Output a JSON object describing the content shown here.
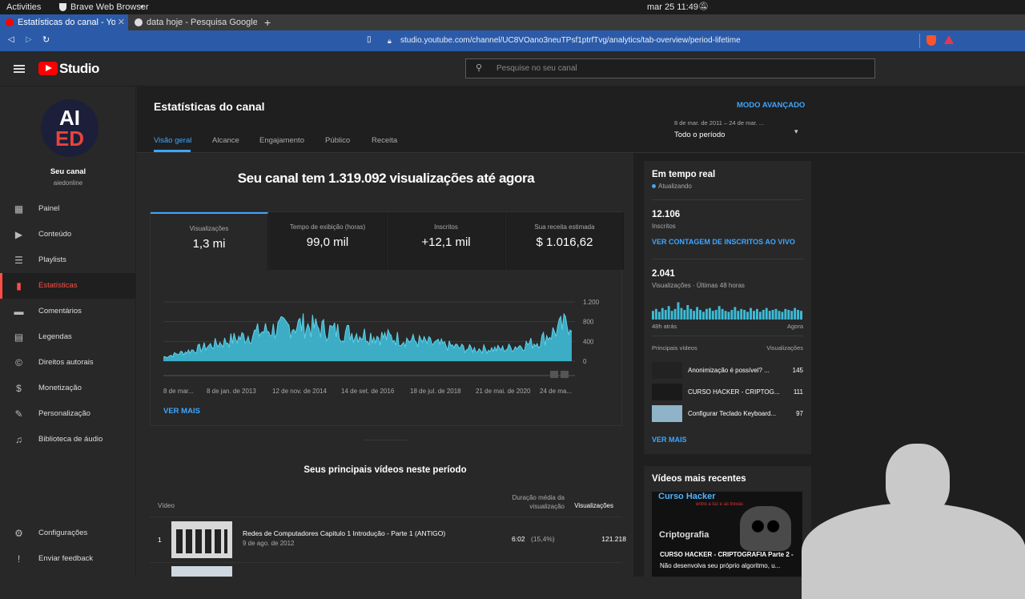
{
  "system_bar": {
    "activities": "Activities",
    "browser_name": "Brave Web Browser",
    "datetime": "mar 25  11:49"
  },
  "browser": {
    "tabs": [
      {
        "title": "Estatísticas do canal - You",
        "active": true
      },
      {
        "title": "data hoje - Pesquisa Google",
        "active": false
      }
    ],
    "new_tab": "+",
    "url": "studio.youtube.com/channel/UC8VOano3neuTPsf1ptrfTvg/analytics/tab-overview/period-lifetime"
  },
  "header": {
    "logo_text": "Studio",
    "search_placeholder": "Pesquise no seu canal"
  },
  "sidebar": {
    "avatar_text_top": "AI",
    "avatar_text_bottom": "ED",
    "channel_title": "Seu canal",
    "channel_handle": "aiedonline",
    "items": [
      {
        "label": "Painel",
        "icon": "dashboard-icon",
        "glyph": "▦"
      },
      {
        "label": "Conteúdo",
        "icon": "content-icon",
        "glyph": "▶"
      },
      {
        "label": "Playlists",
        "icon": "playlists-icon",
        "glyph": "☰"
      },
      {
        "label": "Estatísticas",
        "icon": "analytics-icon",
        "glyph": "▮"
      },
      {
        "label": "Comentários",
        "icon": "comments-icon",
        "glyph": "▬"
      },
      {
        "label": "Legendas",
        "icon": "subtitles-icon",
        "glyph": "▤"
      },
      {
        "label": "Direitos autorais",
        "icon": "copyright-icon",
        "glyph": "©"
      },
      {
        "label": "Monetização",
        "icon": "dollar-icon",
        "glyph": "$"
      },
      {
        "label": "Personalização",
        "icon": "brush-icon",
        "glyph": "✎"
      },
      {
        "label": "Biblioteca de áudio",
        "icon": "audio-library-icon",
        "glyph": "♫"
      }
    ],
    "settings": "Configurações",
    "feedback": "Enviar feedback"
  },
  "page": {
    "title": "Estatísticas do canal",
    "advanced_mode": "MODO AVANÇADO",
    "tabs": [
      "Visão geral",
      "Alcance",
      "Engajamento",
      "Público",
      "Receita"
    ],
    "date_range": "8 de mar. de 2011 – 24 de mar. ...",
    "period": "Todo o período",
    "headline": "Seu canal tem 1.319.092 visualizações até agora",
    "metrics": [
      {
        "label": "Visualizações",
        "value": "1,3 mi"
      },
      {
        "label": "Tempo de exibição (horas)",
        "value": "99,0 mil"
      },
      {
        "label": "Inscritos",
        "value": "+12,1 mil"
      },
      {
        "label": "Sua receita estimada",
        "value": "$ 1.016,62"
      }
    ],
    "see_more": "VER MAIS",
    "top_videos_title": "Seus principais vídeos neste período",
    "table_headers": {
      "video": "Vídeo",
      "avg_duration_l1": "Duração média da",
      "avg_duration_l2": "visualização",
      "views": "Visualizações"
    },
    "top_video": {
      "rank": "1",
      "title": "Redes de Computadores Capitulo 1 Introdução - Parte 1 (ANTIGO)",
      "date": "9 de ago. de 2012",
      "avg_duration": "6:02",
      "avg_pct": "(15,4%)",
      "views": "121.218"
    }
  },
  "chart_data": {
    "type": "area",
    "x_tick_labels": [
      "8 de mar...",
      "8 de jan. de 2013",
      "12 de nov. de 2014",
      "14 de set. de 2016",
      "18 de jul. de 2018",
      "21 de mai. de 2020",
      "24 de ma..."
    ],
    "y_ticks": [
      "1.200",
      "800",
      "400",
      "0"
    ],
    "ylim": [
      0,
      1200
    ],
    "x": [
      "2011",
      "2012",
      "2013",
      "2014",
      "2015",
      "2016",
      "2017",
      "2018",
      "2019",
      "2020",
      "2021",
      "2022",
      "2023"
    ],
    "values": [
      80,
      240,
      420,
      600,
      720,
      600,
      520,
      440,
      340,
      240,
      240,
      380,
      800
    ],
    "color": "#3ebbd6"
  },
  "realtime": {
    "title": "Em tempo real",
    "status": "Atualizando",
    "subs_value": "12.106",
    "subs_label": "Inscritos",
    "live_subs_link": "VER CONTAGEM DE INSCRITOS AO VIVO",
    "views_value": "2.041",
    "views_label": "Visualizações · Últimas 48 horas",
    "axis_left": "48h atrás",
    "axis_right": "Agora",
    "top_videos_label": "Principais vídeos",
    "views_col_label": "Visualizações",
    "videos": [
      {
        "title": "Anonimização é possível? ...",
        "views": "145"
      },
      {
        "title": "CURSO HACKER - CRIPTOG...",
        "views": "111"
      },
      {
        "title": "Configurar Teclado Keyboard...",
        "views": "97"
      }
    ],
    "see_more": "VER MAIS",
    "bars": [
      0.45,
      0.55,
      0.4,
      0.6,
      0.5,
      0.7,
      0.45,
      0.55,
      0.9,
      0.6,
      0.5,
      0.75,
      0.55,
      0.45,
      0.65,
      0.5,
      0.4,
      0.55,
      0.6,
      0.45,
      0.5,
      0.7,
      0.55,
      0.45,
      0.4,
      0.5,
      0.65,
      0.45,
      0.55,
      0.5,
      0.4,
      0.6,
      0.45,
      0.55,
      0.4,
      0.5,
      0.6,
      0.45,
      0.5,
      0.55,
      0.45,
      0.4,
      0.55,
      0.5,
      0.45,
      0.6,
      0.5,
      0.45
    ]
  },
  "latest": {
    "title": "Vídeos mais recentes",
    "thumb_title": "Curso Hacker",
    "thumb_sub": "entre a luz e as trevas",
    "thumb_word": "Criptografia",
    "caption_line1": "CURSO HACKER - CRIPTOGRAFIA Parte 2 -",
    "caption_line2": "Não desenvolva seu próprio algoritmo, u..."
  }
}
